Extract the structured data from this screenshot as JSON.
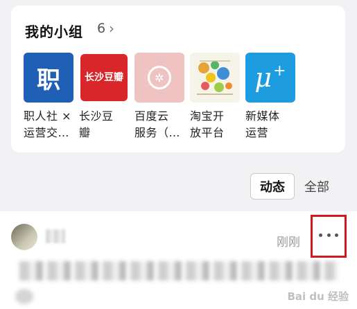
{
  "groups": {
    "title": "我的小组",
    "count": "6",
    "items": [
      {
        "name_line1": "职人社 ×",
        "name_line2": "运营交…",
        "logo_text": "职",
        "logo_icon": "zhi-logo"
      },
      {
        "name_line1": "长沙豆",
        "name_line2": "瓣",
        "logo_text": "长沙豆瓣",
        "logo_icon": "seal-logo"
      },
      {
        "name_line1": "百度云",
        "name_line2": "服务（…",
        "logo_text": "",
        "logo_icon": "baidu-cloud-logo"
      },
      {
        "name_line1": "淘宝开",
        "name_line2": "放平台",
        "logo_text": "",
        "logo_icon": "taobao-open-logo"
      },
      {
        "name_line1": "新媒体",
        "name_line2": "运营",
        "logo_text": "μ",
        "logo_icon": "new-media-logo"
      }
    ]
  },
  "tabs": {
    "active": "动态",
    "all": "全部"
  },
  "post": {
    "timestamp": "刚刚",
    "more_icon": "more-horizontal-icon"
  },
  "colors": {
    "highlight_frame": "#d0191f",
    "zhi_blue": "#1f5fb5",
    "seal_red": "#d9262a",
    "media_blue": "#1d9de0"
  }
}
